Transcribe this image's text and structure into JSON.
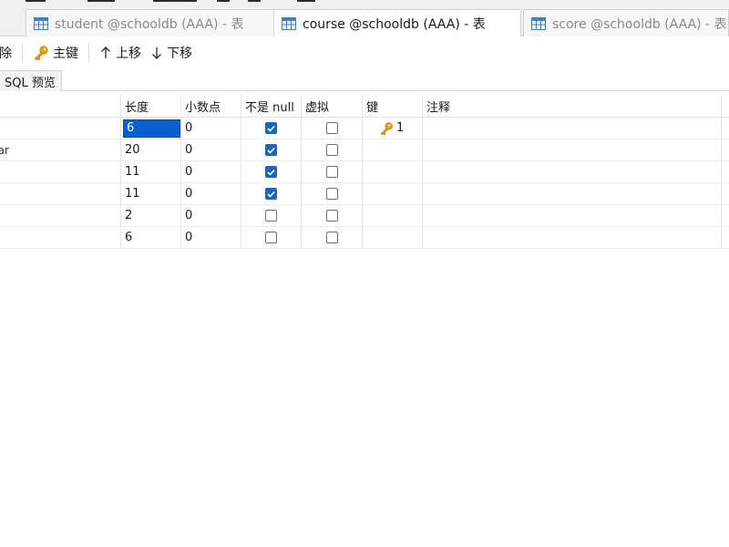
{
  "menu_fragments": [
    "",
    "",
    "",
    "",
    "",
    ""
  ],
  "tabs": [
    {
      "label": "student @schooldb (AAA) - 表",
      "active": false
    },
    {
      "label": "course @schooldb (AAA) - 表",
      "active": true
    },
    {
      "label": "score @schooldb (AAA) - 表",
      "active": false
    }
  ],
  "toolbar": {
    "partial_label": "除",
    "primary_key_label": "主键",
    "move_up_label": "上移",
    "move_down_label": "下移"
  },
  "subtabs": {
    "sql_preview_label": "SQL 预览"
  },
  "columns": {
    "name": "",
    "length": "长度",
    "decimal": "小数点",
    "not_null": "不是 null",
    "virtual": "虚拟",
    "key": "键",
    "comment": "注释"
  },
  "rows": [
    {
      "name": "",
      "length": "6",
      "decimal": "0",
      "not_null": true,
      "virtual": false,
      "key": "1",
      "comment": ""
    },
    {
      "name": "har",
      "length": "20",
      "decimal": "0",
      "not_null": true,
      "virtual": false,
      "key": "",
      "comment": ""
    },
    {
      "name": "",
      "length": "11",
      "decimal": "0",
      "not_null": true,
      "virtual": false,
      "key": "",
      "comment": ""
    },
    {
      "name": "",
      "length": "11",
      "decimal": "0",
      "not_null": true,
      "virtual": false,
      "key": "",
      "comment": ""
    },
    {
      "name": "",
      "length": "2",
      "decimal": "0",
      "not_null": false,
      "virtual": false,
      "key": "",
      "comment": ""
    },
    {
      "name": "",
      "length": "6",
      "decimal": "0",
      "not_null": false,
      "virtual": false,
      "key": "",
      "comment": ""
    }
  ],
  "colors": {
    "selection": "#0a5fd0",
    "checkbox_checked": "#1666c5",
    "key_icon": "#e8a317"
  },
  "icons": {
    "tab": "table-icon",
    "primary_key": "key-icon",
    "move_up": "arrow-up-icon",
    "move_down": "arrow-down-icon"
  }
}
